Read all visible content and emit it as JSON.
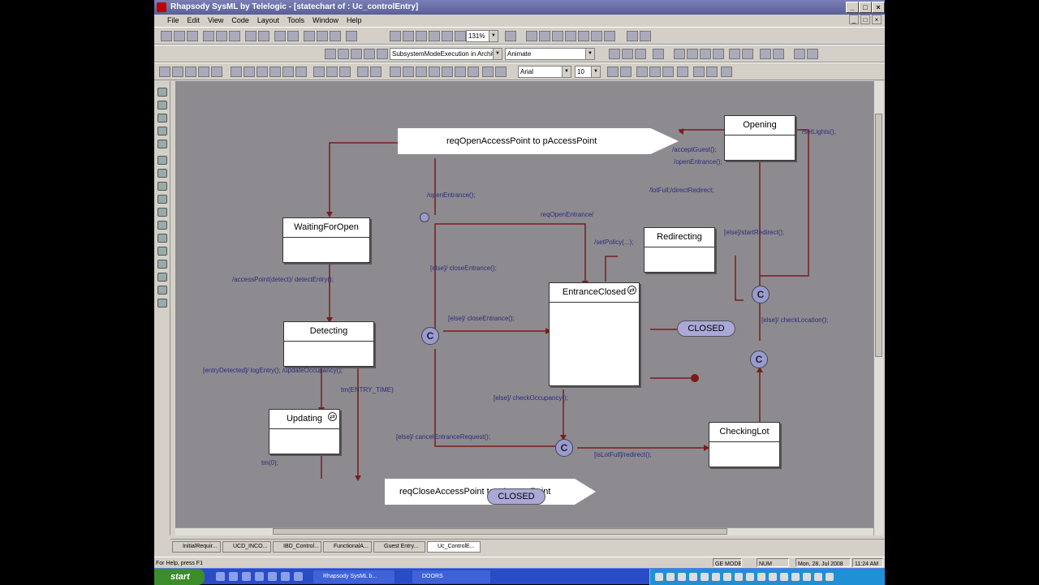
{
  "window": {
    "title": "Rhapsody SysML by Telelogic - [statechart of : Uc_controlEntry]"
  },
  "menu": [
    "File",
    "Edit",
    "View",
    "Code",
    "Layout",
    "Tools",
    "Window",
    "Help"
  ],
  "toolbar": {
    "zoom": "131%",
    "config": "SubsystemModeExecution in Archite",
    "mode": "Animate",
    "font": "Arial",
    "font_size": "10"
  },
  "diagram": {
    "states": {
      "opening": "Opening",
      "waiting": "WaitingForOpen",
      "redirecting": "Redirecting",
      "entrance": "EntranceClosed",
      "detecting": "Detecting",
      "updating": "Updating",
      "checking": "CheckingLot"
    },
    "signals": {
      "open": "reqOpenAccessPoint to pAccessPoint",
      "close": "reqCloseAccessPoint to pAccessPoint"
    },
    "connector": "C",
    "refs": {
      "closed_right": "CLOSED",
      "closed_bottom": "CLOSED"
    },
    "labels": {
      "l1": "/setLights();",
      "l2": "/acceptGuest();",
      "l3": "/openEntrance();",
      "l4": "/openEntrance();",
      "l5": "/lotFull;/directRedirect;",
      "l6": "reqOpenEntrance/",
      "l7": "/setPolicy(...);",
      "l8": "[else]/startRedirect();",
      "l9": "/accessPoint(detect)/ detectEntry();",
      "l10": "[else]/ closeEntrance();",
      "l11": "[else]/ closeEntrance();",
      "l12": "[else]/ checkLocation();",
      "l13": "[entryDetected]/ logEntry(); /updateOccupancy();",
      "l14": "tm(ENTRY_TIME)",
      "l15": "[else]/ checkOccupancy();",
      "l16": "[else]/ cancelEntranceRequest();",
      "l17": "tm(0);",
      "l18": "[isLotFull]/redirect();"
    }
  },
  "tabs": [
    "InitialRequir...",
    "UCD_INCO...",
    "IBD_Control...",
    "FunctionalA...",
    "Guest Entry...",
    "Uc_ControlE..."
  ],
  "status": {
    "help": "For Help, press F1",
    "mode": "GE MODE",
    "num": "NUM",
    "date": "Mon, 28, Jul 2008",
    "time": "11:24 AM"
  },
  "taskbar": {
    "start": "start",
    "tasks": [
      "Rhapsody SysML b...",
      "DOORS"
    ]
  }
}
